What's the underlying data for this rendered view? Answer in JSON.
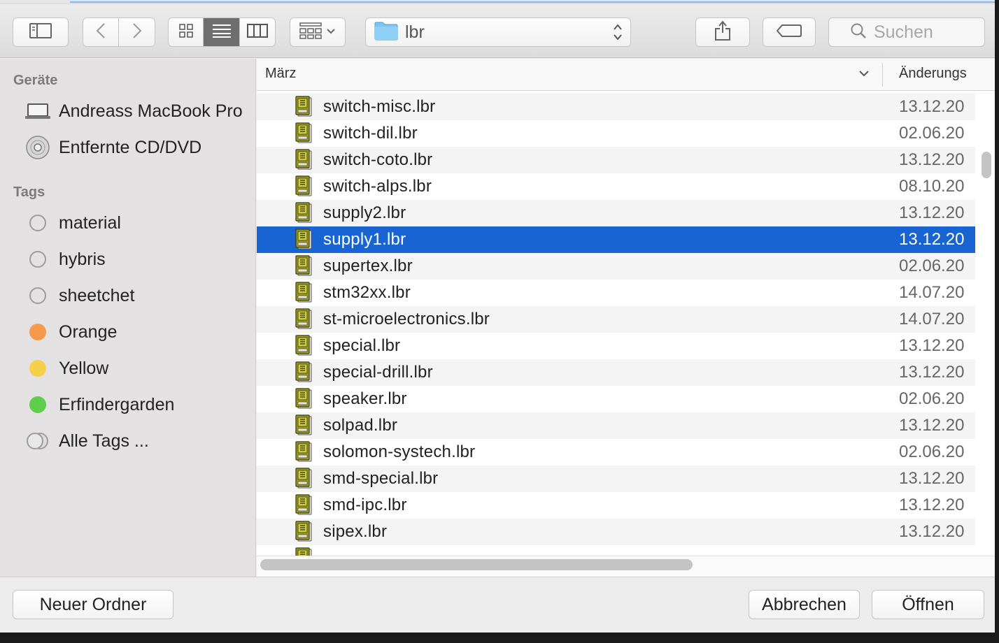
{
  "toolbar": {
    "path_label": "lbr",
    "search_placeholder": "Suchen",
    "view_modes": [
      "icon",
      "list",
      "column"
    ],
    "active_view": "list"
  },
  "sidebar": {
    "devices_header": "Geräte",
    "devices": [
      {
        "label": "Andreass MacBook Pro",
        "icon": "laptop-icon"
      },
      {
        "label": "Entfernte CD/DVD",
        "icon": "disc-icon"
      }
    ],
    "tags_header": "Tags",
    "tags": [
      {
        "label": "material",
        "color": "#e3e1e2"
      },
      {
        "label": "hybris",
        "color": "#e3e1e2"
      },
      {
        "label": "sheetchet",
        "color": "#e3e1e2"
      },
      {
        "label": "Orange",
        "color": "#f59a4a"
      },
      {
        "label": "Yellow",
        "color": "#f6d04a"
      },
      {
        "label": "Erfindergarden",
        "color": "#5fcd4b"
      },
      {
        "label": "Alle Tags ...",
        "color": "all"
      }
    ]
  },
  "list": {
    "col_name": "März",
    "col_date": "Änderungs",
    "selected_index": 5,
    "files": [
      {
        "name": "switch-misc.lbr",
        "date": "13.12.20"
      },
      {
        "name": "switch-dil.lbr",
        "date": "02.06.20"
      },
      {
        "name": "switch-coto.lbr",
        "date": "13.12.20"
      },
      {
        "name": "switch-alps.lbr",
        "date": "08.10.20"
      },
      {
        "name": "supply2.lbr",
        "date": "13.12.20"
      },
      {
        "name": "supply1.lbr",
        "date": "13.12.20"
      },
      {
        "name": "supertex.lbr",
        "date": "02.06.20"
      },
      {
        "name": "stm32xx.lbr",
        "date": "14.07.20"
      },
      {
        "name": "st-microelectronics.lbr",
        "date": "14.07.20"
      },
      {
        "name": "special.lbr",
        "date": "13.12.20"
      },
      {
        "name": "special-drill.lbr",
        "date": "13.12.20"
      },
      {
        "name": "speaker.lbr",
        "date": "02.06.20"
      },
      {
        "name": "solpad.lbr",
        "date": "13.12.20"
      },
      {
        "name": "solomon-systech.lbr",
        "date": "02.06.20"
      },
      {
        "name": "smd-special.lbr",
        "date": "13.12.20"
      },
      {
        "name": "smd-ipc.lbr",
        "date": "13.12.20"
      },
      {
        "name": "sipex.lbr",
        "date": "13.12.20"
      }
    ]
  },
  "footer": {
    "new_folder": "Neuer Ordner",
    "cancel": "Abbrechen",
    "open": "Öffnen"
  }
}
